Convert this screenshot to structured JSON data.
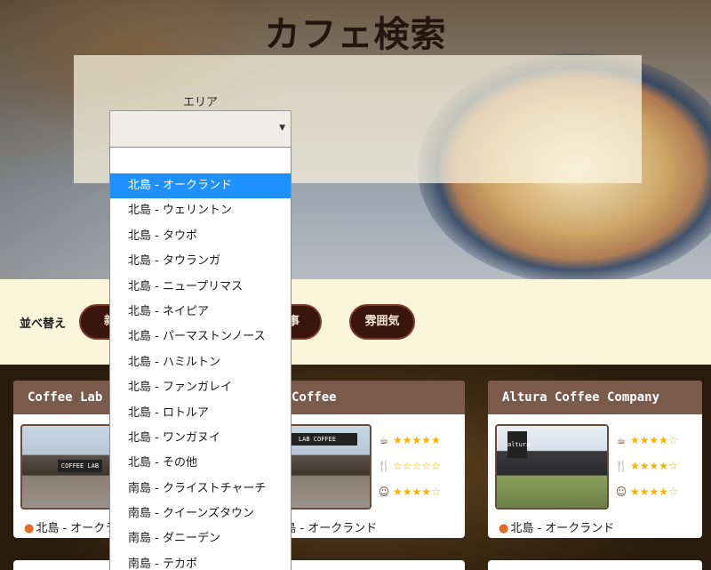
{
  "header": {
    "title": "カフェ検索"
  },
  "search": {
    "area_label": "エリア",
    "area_value": "",
    "area_options": [
      "北島 - オークランド",
      "北島 - ウェリントン",
      "北島 - タウポ",
      "北島 - タウランガ",
      "北島 - ニュープリマス",
      "北島 - ネイピア",
      "北島 - パーマストンノース",
      "北島 - ハミルトン",
      "北島 - ファンガレイ",
      "北島 - ロトルア",
      "北島 - ワンガヌイ",
      "北島 - その他",
      "南島 - クライストチャーチ",
      "南島 - クイーンズタウン",
      "南島 - ダニーデン",
      "南島 - テカポ"
    ],
    "highlighted_index": 0
  },
  "sort": {
    "label": "並べ替え",
    "buttons": [
      "新着",
      "食事",
      "雰囲気"
    ]
  },
  "cards": [
    {
      "name": "Coffee Lab",
      "photo_sign": "COFFEE LAB",
      "ratings": {
        "coffee": "★★★★★",
        "food": "☆☆☆☆☆",
        "atmosphere": "★★★★☆"
      },
      "location": "北島 - オークランド"
    },
    {
      "name": "Coffee",
      "photo_sign": "LAB COFFEE",
      "ratings": {
        "coffee": "★★★★★",
        "food": "☆☆☆☆☆",
        "atmosphere": "★★★★☆"
      },
      "location": "北島 - オークランド"
    },
    {
      "name": "Altura Coffee Company",
      "photo_sign": "altura",
      "ratings": {
        "coffee": "★★★★☆",
        "food": "★★★★☆",
        "atmosphere": "★★★★☆"
      },
      "location": "北島 - オークランド"
    }
  ],
  "icons": {
    "coffee": "coffee-cup-icon",
    "food": "fork-knife-icon",
    "atmosphere": "smiley-icon",
    "location": "map-pin-icon"
  },
  "colors": {
    "pill_bg": "#3a150c",
    "card_header": "#7a5a4a",
    "star": "#f5b400",
    "highlight": "#1e90ff"
  }
}
